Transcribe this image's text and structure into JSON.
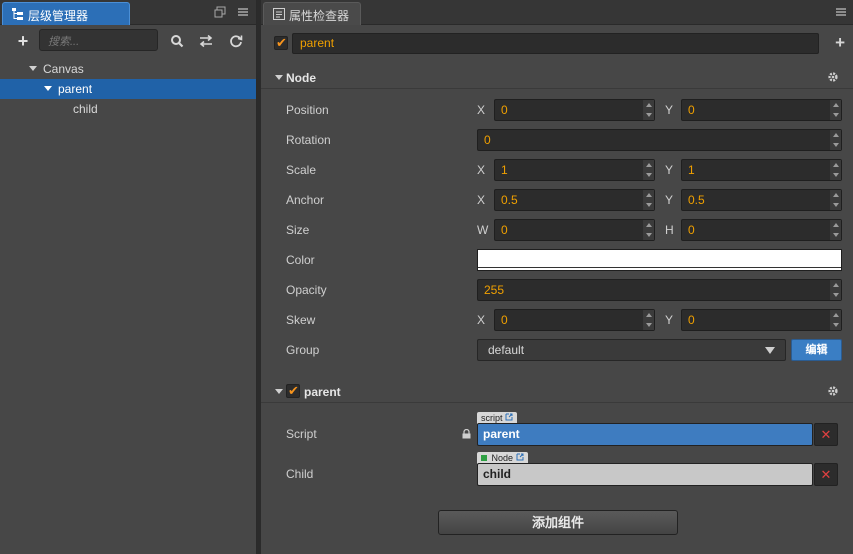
{
  "hierarchy": {
    "tab_label": "层级管理器",
    "search_placeholder": "搜索...",
    "tree": [
      {
        "label": "Canvas",
        "expanded": true,
        "selected": false
      },
      {
        "label": "parent",
        "expanded": true,
        "selected": true
      },
      {
        "label": "child",
        "expanded": false,
        "selected": false
      }
    ]
  },
  "inspector": {
    "tab_label": "属性检查器",
    "node_name": "parent",
    "node_enabled": true,
    "node_section": {
      "title": "Node",
      "position": {
        "label": "Position",
        "x_label": "X",
        "x": "0",
        "y_label": "Y",
        "y": "0"
      },
      "rotation": {
        "label": "Rotation",
        "value": "0"
      },
      "scale": {
        "label": "Scale",
        "x_label": "X",
        "x": "1",
        "y_label": "Y",
        "y": "1"
      },
      "anchor": {
        "label": "Anchor",
        "x_label": "X",
        "x": "0.5",
        "y_label": "Y",
        "y": "0.5"
      },
      "size": {
        "label": "Size",
        "w_label": "W",
        "w": "0",
        "h_label": "H",
        "h": "0"
      },
      "color": {
        "label": "Color",
        "value": "#ffffff"
      },
      "opacity": {
        "label": "Opacity",
        "value": "255"
      },
      "skew": {
        "label": "Skew",
        "x_label": "X",
        "x": "0",
        "y_label": "Y",
        "y": "0"
      },
      "group": {
        "label": "Group",
        "value": "default",
        "edit_label": "编辑"
      }
    },
    "component": {
      "title": "parent",
      "enabled": true,
      "script": {
        "label": "Script",
        "tag": "script",
        "value": "parent"
      },
      "child": {
        "label": "Child",
        "tag": "Node",
        "value": "child"
      }
    },
    "add_component_label": "添加组件"
  },
  "colors": {
    "accent": "#2c6fb7",
    "selection": "#2062a8",
    "value_text": "#f0a000",
    "checkbox": "#f7941d",
    "script_field": "#3e7cc0"
  }
}
